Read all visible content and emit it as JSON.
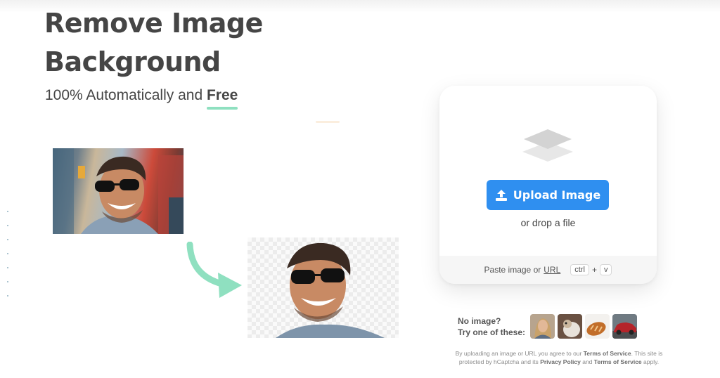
{
  "hero": {
    "title": "Remove Image Background",
    "subtitle_prefix": "100% Automatically and",
    "subtitle_emphasis": "Free"
  },
  "upload": {
    "button_label": "Upload Image",
    "drop_text": "or drop a file",
    "paste_prefix": "Paste image or",
    "paste_link": "URL",
    "shortcut_ctrl": "ctrl",
    "shortcut_plus": "+",
    "shortcut_v": "v"
  },
  "samples": {
    "prompt_line1": "No image?",
    "prompt_line2": "Try one of these:",
    "items": [
      "woman-portrait",
      "animal",
      "bread",
      "car"
    ]
  },
  "legal": {
    "p1": "By uploading an image or URL you agree to our",
    "tos": "Terms of Service",
    "p2": ". This site is protected by hCaptcha and its",
    "privacy": "Privacy Policy",
    "p3": "and",
    "tos2": "Terms of Service",
    "p4": "apply."
  },
  "colors": {
    "accent": "#2f8ff0",
    "highlight": "#8fe0c0",
    "text": "#454545"
  }
}
